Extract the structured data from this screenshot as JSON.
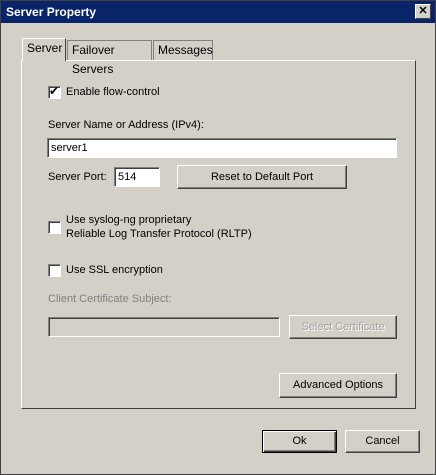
{
  "window": {
    "title": "Server Property",
    "close_symbol": "✕"
  },
  "tabs": [
    {
      "label": "Server",
      "active": true
    },
    {
      "label": "Failover Servers",
      "active": false
    },
    {
      "label": "Messages",
      "active": false
    }
  ],
  "server_tab": {
    "flow_control": {
      "label": "Enable flow-control",
      "checked": true,
      "mark": "✔"
    },
    "server_name": {
      "label": "Server Name or Address (IPv4):",
      "value": "server1"
    },
    "server_port": {
      "label": "Server Port:",
      "value": "514"
    },
    "reset_button": "Reset to Default Port",
    "rltp": {
      "line1": "Use  syslog-ng  proprietary",
      "line2": "Reliable Log Transfer Protocol (RLTP)",
      "checked": false
    },
    "ssl": {
      "label": "Use SSL encryption",
      "checked": false
    },
    "client_cert": {
      "label": "Client Certificate Subject:",
      "value": ""
    },
    "select_cert_button": "Select Certificate",
    "advanced_button": "Advanced Options"
  },
  "footer": {
    "ok": "Ok",
    "cancel": "Cancel"
  }
}
